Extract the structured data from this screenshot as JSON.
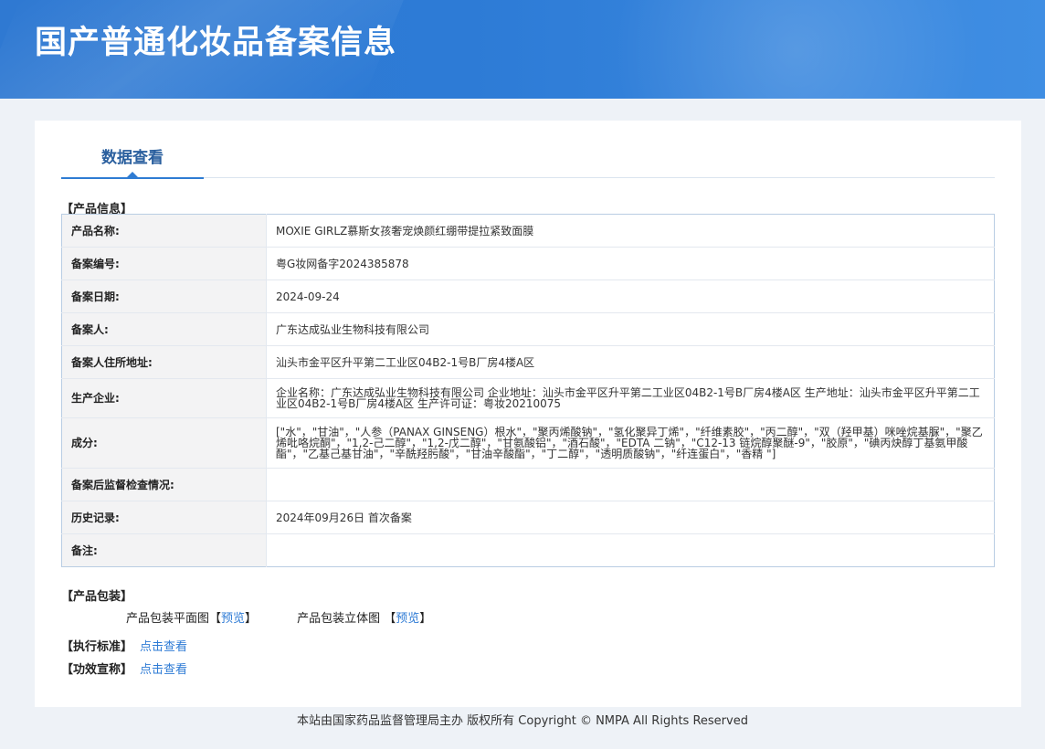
{
  "header": {
    "title": "国产普通化妆品备案信息"
  },
  "tabs": {
    "active_label": "数据查看"
  },
  "product_info": {
    "section_title": "【产品信息】",
    "rows": [
      {
        "label": "产品名称:",
        "value": "MOXIE GIRLZ慕斯女孩奢宠焕颜红绷带提拉紧致面膜"
      },
      {
        "label": "备案编号:",
        "value": "粤G妆网备字2024385878"
      },
      {
        "label": "备案日期:",
        "value": "2024-09-24"
      },
      {
        "label": "备案人:",
        "value": "广东达成弘业生物科技有限公司"
      },
      {
        "label": "备案人住所地址:",
        "value": "汕头市金平区升平第二工业区04B2-1号B厂房4楼A区"
      },
      {
        "label": "生产企业:",
        "value": "企业名称：广东达成弘业生物科技有限公司 企业地址：汕头市金平区升平第二工业区04B2-1号B厂房4楼A区 生产地址：汕头市金平区升平第二工业区04B2-1号B厂房4楼A区 生产许可证：粤妆20210075"
      },
      {
        "label": "成分:",
        "value": "[\"水\"，\"甘油\"，\"人参（PANAX GINSENG）根水\"，\"聚丙烯酸钠\"，\"氢化聚异丁烯\"，\"纤维素胶\"，\"丙二醇\"，\"双（羟甲基）咪唑烷基脲\"，\"聚乙烯吡咯烷酮\"，\"1,2-己二醇\"，\"1,2-戊二醇\"，\"甘氨酸铝\"，\"酒石酸\"，\"EDTA 二钠\"，\"C12-13 链烷醇聚醚-9\"，\"胶原\"，\"碘丙炔醇丁基氨甲酸酯\"，\"乙基己基甘油\"，\"辛酰羟肟酸\"，\"甘油辛酸酯\"，\"丁二醇\"，\"透明质酸钠\"，\"纤连蛋白\"，\"香精 \"]"
      },
      {
        "label": "备案后监督检查情况:",
        "value": ""
      },
      {
        "label": "历史记录:",
        "value": "2024年09月26日 首次备案"
      },
      {
        "label": "备注:",
        "value": ""
      }
    ]
  },
  "packaging": {
    "section_title": "【产品包装】",
    "flat_label": "产品包装平面图",
    "solid_label": "产品包装立体图",
    "preview": "预览",
    "bracket_open": "【",
    "bracket_close": "】"
  },
  "standards": {
    "label": "【执行标准】",
    "link": "点击查看"
  },
  "claims": {
    "label": "【功效宣称】",
    "link": "点击查看"
  },
  "footer": {
    "text": "本站由国家药品监督管理局主办 版权所有 Copyright © NMPA All Rights Reserved"
  }
}
